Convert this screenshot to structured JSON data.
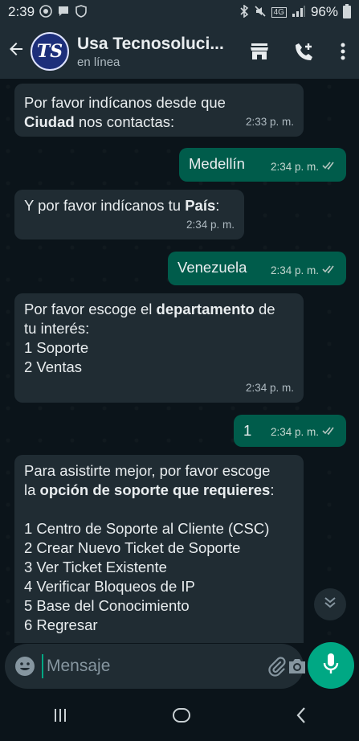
{
  "status_bar": {
    "time": "2:39",
    "lte": "4G",
    "battery": "96%"
  },
  "header": {
    "title": "Usa Tecnosoluci...",
    "subtitle": "en línea",
    "avatar_text": "TS"
  },
  "messages": [
    {
      "dir": "in",
      "segments": [
        {
          "t": "Por favor indícanos desde que\n",
          "b": false
        },
        {
          "t": "Ciudad",
          "b": true
        },
        {
          "t": " nos contactas:",
          "b": false
        }
      ],
      "time": "2:33 p. m."
    },
    {
      "dir": "out",
      "segments": [
        {
          "t": "Medellín",
          "b": false
        }
      ],
      "time": "2:34 p. m."
    },
    {
      "dir": "in",
      "segments": [
        {
          "t": "Y por favor indícanos tu ",
          "b": false
        },
        {
          "t": "País",
          "b": true
        },
        {
          "t": ":",
          "b": false
        }
      ],
      "time": "2:34 p. m."
    },
    {
      "dir": "out",
      "segments": [
        {
          "t": "Venezuela",
          "b": false
        }
      ],
      "time": "2:34 p. m."
    },
    {
      "dir": "in",
      "segments": [
        {
          "t": "Por favor escoge el ",
          "b": false
        },
        {
          "t": "departamento",
          "b": true
        },
        {
          "t": " de\ntu interés:\n1 Soporte\n2 Ventas",
          "b": false
        }
      ],
      "time": "2:34 p. m."
    },
    {
      "dir": "out",
      "segments": [
        {
          "t": "1",
          "b": false
        }
      ],
      "time": "2:34 p. m."
    },
    {
      "dir": "in",
      "segments": [
        {
          "t": "Para asistirte mejor, por favor escoge\nla ",
          "b": false
        },
        {
          "t": "opción de soporte que requieres",
          "b": true
        },
        {
          "t": ":\n\n1 Centro de Soporte al Cliente (CSC)\n2 Crear Nuevo Ticket de Soporte\n3 Ver Ticket Existente\n4 Verificar Bloqueos de IP\n5 Base del Conocimiento\n6 Regresar",
          "b": false
        }
      ],
      "time": ""
    }
  ],
  "composer": {
    "placeholder": "Mensaje"
  },
  "colors": {
    "header_bg": "#1f2c34",
    "chat_bg": "#0b141a",
    "incoming": "#202c33",
    "outgoing": "#005c4b",
    "accent": "#00a884"
  }
}
